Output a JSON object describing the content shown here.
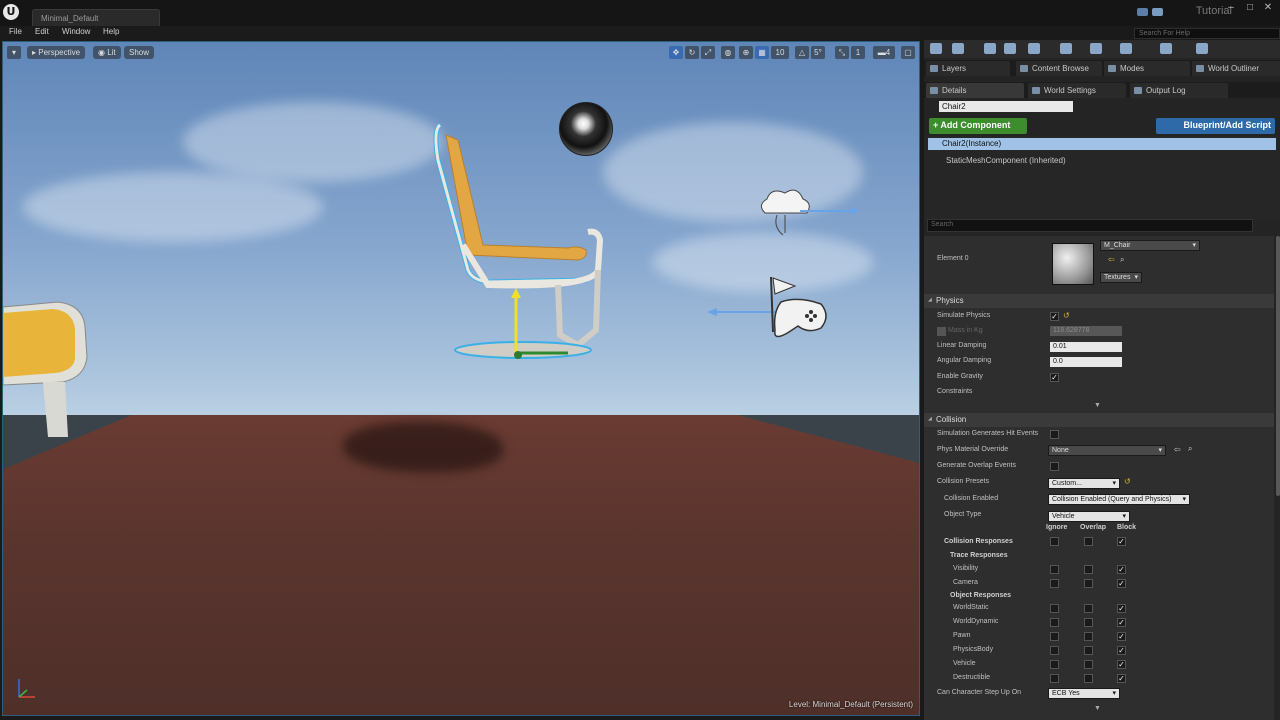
{
  "window": {
    "doc_tab": "Minimal_Default",
    "tutorial": "Tutorial",
    "search_help_placeholder": "Search For Help",
    "minimize": "–",
    "maximize": "□",
    "close": "✕"
  },
  "menu": [
    "File",
    "Edit",
    "Window",
    "Help"
  ],
  "viewport": {
    "perspective": "Perspective",
    "lit": "Lit",
    "show": "Show",
    "grid_snap": "10",
    "rot_snap": "5°",
    "scale_snap": "1",
    "cam_speed": "4",
    "level_label": "Level:",
    "level_name": "Minimal_Default (Persistent)"
  },
  "panel": {
    "tabs_top": [
      "Layers",
      "Content Browse",
      "Modes",
      "World Outliner"
    ],
    "tabs_second": [
      "Details",
      "World Settings",
      "Output Log"
    ],
    "actor_name": "Chair2",
    "add_component": "+ Add Component",
    "blueprint": "Blueprint/Add Script",
    "component_selected": "Chair2(Instance)",
    "component_child": "StaticMeshComponent (Inherited)",
    "search_placeholder": "Search",
    "element0": "Element 0",
    "material": "M_Chair",
    "textures": "Textures",
    "physics": {
      "title": "Physics",
      "simulate": "Simulate Physics",
      "mass": "Mass in Kg",
      "mass_value": "118.628778",
      "linear_damping": "Linear Damping",
      "linear_damping_value": "0.01",
      "angular_damping": "Angular Damping",
      "angular_damping_value": "0.0",
      "enable_gravity": "Enable Gravity",
      "constraints": "Constraints"
    },
    "collision": {
      "title": "Collision",
      "sim_hit": "Simulation Generates Hit Events",
      "phys_mat": "Phys Material Override",
      "phys_mat_value": "None",
      "overlap_events": "Generate Overlap Events",
      "presets": "Collision Presets",
      "presets_value": "Custom...",
      "enabled": "Collision Enabled",
      "enabled_value": "Collision Enabled (Query and Physics)",
      "object_type": "Object Type",
      "object_type_value": "Vehicle",
      "col_ignore": "Ignore",
      "col_overlap": "Overlap",
      "col_block": "Block",
      "responses": "Collision Responses",
      "trace_responses": "Trace Responses",
      "visibility": "Visibility",
      "camera": "Camera",
      "object_responses": "Object Responses",
      "world_static": "WorldStatic",
      "world_dynamic": "WorldDynamic",
      "pawn": "Pawn",
      "physics_body": "PhysicsBody",
      "vehicle": "Vehicle",
      "destructible": "Destructible",
      "step_up": "Can Character Step Up On",
      "step_up_value": "ECB Yes"
    }
  }
}
